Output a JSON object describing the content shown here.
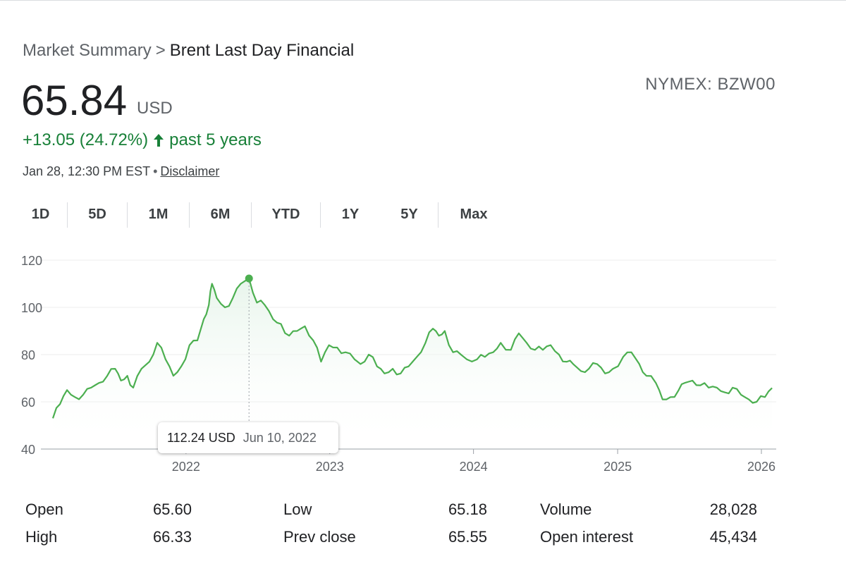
{
  "breadcrumb": {
    "parent": "Market Summary",
    "separator": ">",
    "current": "Brent Last Day Financial"
  },
  "ticker": "NYMEX: BZW00",
  "price": {
    "value": "65.84",
    "currency": "USD"
  },
  "change": {
    "text": "+13.05 (24.72%)",
    "period": "past 5 years",
    "direction": "up",
    "color": "#188038"
  },
  "timestamp": {
    "text": "Jan 28, 12:30 PM EST",
    "separator": "•",
    "disclaimer": "Disclaimer"
  },
  "tabs": [
    {
      "label": "1D",
      "active": false
    },
    {
      "label": "5D",
      "active": false
    },
    {
      "label": "1M",
      "active": false
    },
    {
      "label": "6M",
      "active": false
    },
    {
      "label": "YTD",
      "active": false
    },
    {
      "label": "1Y",
      "active": false
    },
    {
      "label": "5Y",
      "active": true
    },
    {
      "label": "Max",
      "active": false
    }
  ],
  "tooltip": {
    "value": "112.24 USD",
    "date": "Jun 10, 2022"
  },
  "stats": [
    [
      {
        "label": "Open",
        "value": "65.60"
      },
      {
        "label": "Low",
        "value": "65.18"
      },
      {
        "label": "Volume",
        "value": "28,028"
      }
    ],
    [
      {
        "label": "High",
        "value": "66.33"
      },
      {
        "label": "Prev close",
        "value": "65.55"
      },
      {
        "label": "Open interest",
        "value": "45,434"
      }
    ]
  ],
  "colors": {
    "line": "#4caf50",
    "accent": "#1a73e8",
    "positive": "#188038"
  },
  "chart_data": {
    "type": "area",
    "title": "",
    "xlabel": "",
    "ylabel": "",
    "ylim": [
      40,
      120
    ],
    "yticks": [
      40,
      60,
      80,
      100,
      120
    ],
    "xticks": [
      "2022",
      "2023",
      "2024",
      "2025",
      "2026"
    ],
    "grid": true,
    "highlight": {
      "x": "2022-06-10",
      "y": 112.24
    },
    "series": [
      {
        "x": [
          "2021-01-28",
          "2021-02-15",
          "2021-03-05",
          "2021-03-25",
          "2021-04-15",
          "2021-05-05",
          "2021-05-25",
          "2021-06-15",
          "2021-07-05",
          "2021-07-20",
          "2021-08-05",
          "2021-08-20",
          "2021-09-10",
          "2021-09-30",
          "2021-10-20",
          "2021-11-10",
          "2021-11-30",
          "2021-12-20",
          "2022-01-10",
          "2022-01-30",
          "2022-02-15",
          "2022-02-28",
          "2022-03-08",
          "2022-03-20",
          "2022-04-10",
          "2022-04-30",
          "2022-05-20",
          "2022-06-10",
          "2022-06-30",
          "2022-07-20",
          "2022-08-10",
          "2022-08-30",
          "2022-09-20",
          "2022-10-10",
          "2022-10-30",
          "2022-11-20",
          "2022-12-10",
          "2022-12-30",
          "2023-01-20",
          "2023-02-10",
          "2023-03-05",
          "2023-03-20",
          "2023-04-10",
          "2023-05-01",
          "2023-05-20",
          "2023-06-10",
          "2023-06-30",
          "2023-07-20",
          "2023-08-10",
          "2023-09-01",
          "2023-09-20",
          "2023-10-05",
          "2023-10-20",
          "2023-11-10",
          "2023-11-30",
          "2023-12-15",
          "2024-01-10",
          "2024-01-30",
          "2024-02-20",
          "2024-03-10",
          "2024-04-05",
          "2024-04-25",
          "2024-05-15",
          "2024-06-05",
          "2024-06-25",
          "2024-07-15",
          "2024-08-05",
          "2024-08-25",
          "2024-09-10",
          "2024-09-30",
          "2024-10-20",
          "2024-11-10",
          "2024-11-30",
          "2024-12-20",
          "2025-01-15",
          "2025-02-05",
          "2025-02-25",
          "2025-03-15",
          "2025-04-08",
          "2025-04-25",
          "2025-05-15",
          "2025-06-05",
          "2025-06-20",
          "2025-07-10",
          "2025-07-30",
          "2025-08-20",
          "2025-09-10",
          "2025-09-30",
          "2025-10-20",
          "2025-11-10",
          "2025-11-30",
          "2025-12-20",
          "2026-01-10",
          "2026-01-28"
        ],
        "values": [
          53,
          59,
          65,
          62,
          63,
          66,
          68,
          71,
          74,
          69,
          71,
          66,
          74,
          77,
          85,
          78,
          71,
          75,
          84,
          86,
          95,
          101,
          110,
          104,
          100,
          104,
          110,
          112.24,
          102,
          101,
          95,
          93,
          88,
          90,
          92,
          86,
          77,
          84,
          83,
          81,
          78,
          76,
          80,
          75,
          72,
          74,
          72,
          75,
          79,
          85,
          91,
          88,
          90,
          81,
          80,
          78,
          78,
          79,
          81,
          85,
          82,
          89,
          85,
          82,
          82,
          84,
          80,
          77,
          76,
          73,
          74,
          76,
          72,
          74,
          79,
          81,
          76,
          71,
          68,
          61,
          62,
          65,
          68,
          69,
          67,
          66,
          66,
          64,
          66,
          63,
          61,
          60,
          62,
          65.84
        ]
      }
    ]
  }
}
